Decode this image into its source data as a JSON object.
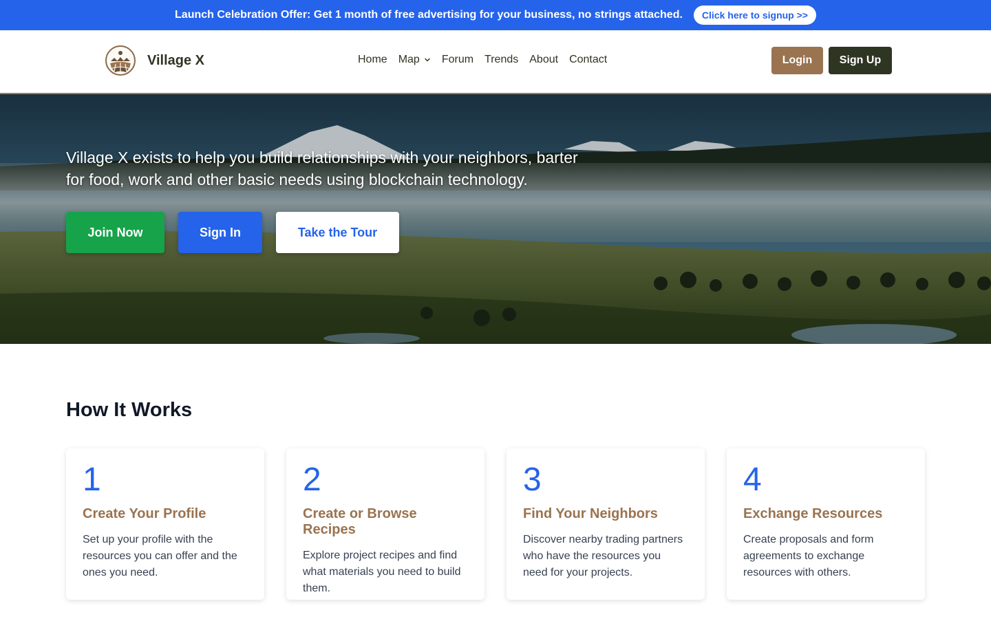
{
  "banner": {
    "text": "Launch Celebration Offer: Get 1 month of free advertising for your business, no strings attached.",
    "cta_label": "Click here to signup >>"
  },
  "header": {
    "brand_name": "Village X",
    "logo_icon": "village-logo-icon",
    "nav": [
      {
        "label": "Home"
      },
      {
        "label": "Map",
        "icon": "chevron-down-icon"
      },
      {
        "label": "Forum"
      },
      {
        "label": "Trends"
      },
      {
        "label": "About"
      },
      {
        "label": "Contact"
      }
    ],
    "login_label": "Login",
    "signup_label": "Sign Up"
  },
  "hero": {
    "text": "Village X exists to help you build relationships with your neighbors, barter for food, work and other basic needs using blockchain technology.",
    "join_label": "Join Now",
    "signin_label": "Sign In",
    "tour_label": "Take the Tour"
  },
  "how": {
    "title": "How It Works",
    "steps": [
      {
        "number": "1",
        "title": "Create Your Profile",
        "desc": "Set up your profile with the resources you can offer and the ones you need."
      },
      {
        "number": "2",
        "title": "Create or Browse Recipes",
        "desc": "Explore project recipes and find what materials you need to build them."
      },
      {
        "number": "3",
        "title": "Find Your Neighbors",
        "desc": "Discover nearby trading partners who have the resources you need for your projects."
      },
      {
        "number": "4",
        "title": "Exchange Resources",
        "desc": "Create proposals and form agreements to exchange resources with others."
      }
    ]
  },
  "colors": {
    "banner": "#2563eb",
    "brand_brown": "#9a7350",
    "brand_dark": "#2f3523",
    "join_green": "#16a34a",
    "accent_blue": "#2563eb"
  }
}
